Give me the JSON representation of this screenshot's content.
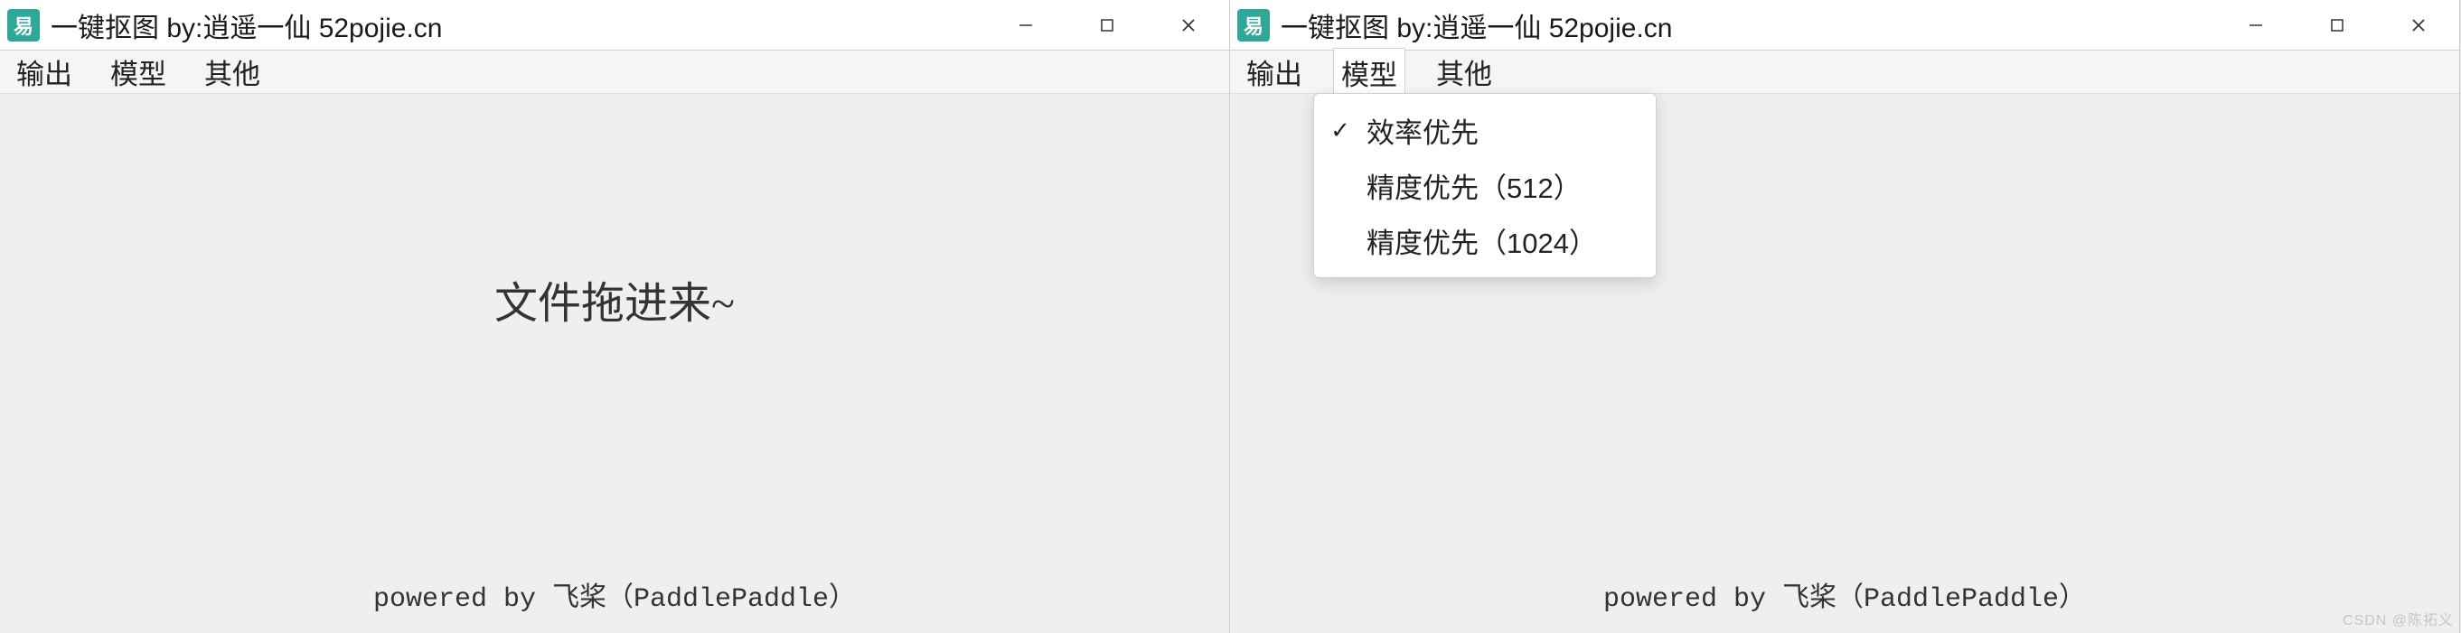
{
  "window1": {
    "icon_glyph": "易",
    "title": "一键抠图  by:逍遥一仙 52pojie.cn",
    "menu": {
      "output": "输出",
      "model": "模型",
      "other": "其他"
    },
    "drop_hint": "文件拖进来~",
    "footer": "powered by 飞桨（PaddlePaddle）"
  },
  "window2": {
    "icon_glyph": "易",
    "title": "一键抠图  by:逍遥一仙 52pojie.cn",
    "menu": {
      "output": "输出",
      "model": "模型",
      "other": "其他"
    },
    "dropdown": {
      "items": [
        {
          "label": "效率优先",
          "checked": true
        },
        {
          "label": "精度优先（512）",
          "checked": false
        },
        {
          "label": "精度优先（1024）",
          "checked": false
        }
      ]
    },
    "footer": "powered by 飞桨（PaddlePaddle）",
    "watermark": "CSDN @陈拓义"
  },
  "glyphs": {
    "check": "✓"
  }
}
